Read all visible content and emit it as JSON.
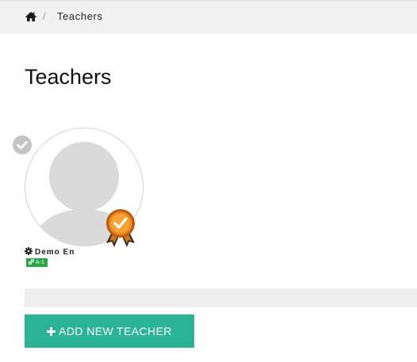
{
  "breadcrumb": {
    "home_icon": "home-icon",
    "separator": "/",
    "current": "Teachers"
  },
  "page": {
    "title": "Teachers"
  },
  "teachers": [
    {
      "name": "Demo En",
      "name_icon": "gear-icon",
      "class_tag": "A-1",
      "class_tag_icon": "link-icon",
      "class_tag_color": "#28a745",
      "avatar": "default-user-avatar",
      "badge": "award-ribbon-badge",
      "selected_icon": "check-circle-icon"
    }
  ],
  "actions": {
    "add_label": "ADD NEW TEACHER",
    "add_icon": "plus-icon",
    "add_color": "#2ab394"
  }
}
